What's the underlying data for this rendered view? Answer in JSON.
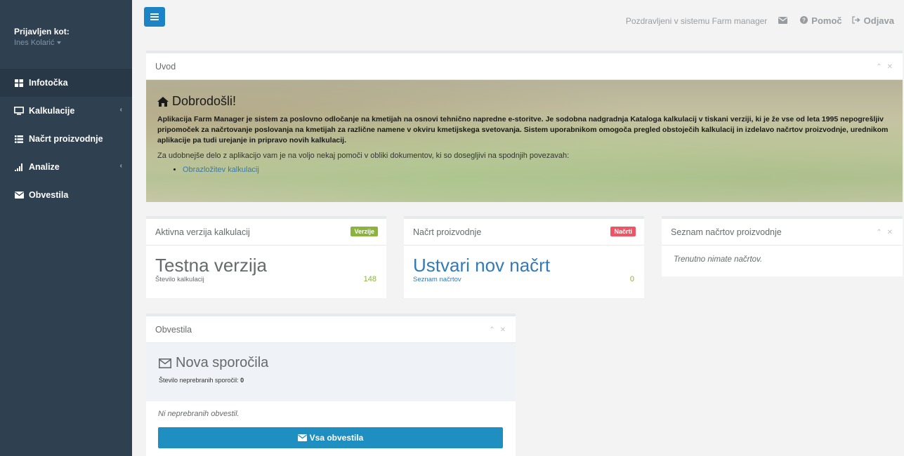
{
  "sidebar": {
    "profile_label": "Prijavljen kot:",
    "user_name": "Ines Kolarić",
    "items": [
      {
        "label": "Infotočka",
        "icon": "grid-icon",
        "active": true
      },
      {
        "label": "Kalkulacije",
        "icon": "desktop-icon",
        "has_submenu": true
      },
      {
        "label": "Načrt proizvodnje",
        "icon": "list-icon"
      },
      {
        "label": "Analize",
        "icon": "bar-chart-icon",
        "has_submenu": true
      },
      {
        "label": "Obvestila",
        "icon": "envelope-icon"
      }
    ]
  },
  "header": {
    "welcome": "Pozdravljeni v sistemu Farm manager",
    "help_label": "Pomoč",
    "logout_label": "Odjava"
  },
  "uvod": {
    "title": "Uvod",
    "heading": "Dobrodošli!",
    "intro": "Aplikacija Farm Manager je sistem za poslovno odločanje na kmetijah na osnovi tehnično napredne e-storitve. Je sodobna nadgradnja Kataloga kalkulacij v tiskani verziji, ki je že vse od leta 1995 nepogrešljiv pripomoček za načrtovanje poslovanja na kmetijah za različne namene v okviru kmetijskega svetovanja. Sistem uporabnikom omogoča pregled obstoječih kalkulacij in izdelavo načrtov proizvodnje, urednikom aplikacije pa tudi urejanje in pripravo novih kalkulacij.",
    "help_text": "Za udobnejše delo z aplikacijo vam je na voljo nekaj pomoči v obliki dokumentov, ki so dosegljivi na spodnjih povezavah:",
    "link": "Obrazložitev kalkulacij"
  },
  "version_box": {
    "title": "Aktivna verzija kalkulacij",
    "badge": "Verzije",
    "badge_color": "#8bb43a",
    "value": "Testna verzija",
    "sub_label": "Število kalkulacij",
    "count": "148"
  },
  "plan_box": {
    "title": "Načrt proizvodnje",
    "badge": "Načrti",
    "badge_color": "#ed5565",
    "value": "Ustvari nov načrt",
    "sub_label": "Seznam načrtov",
    "count": "0"
  },
  "plans_list": {
    "title": "Seznam načrtov proizvodnje",
    "empty": "Trenutno nimate načrtov."
  },
  "notifications": {
    "title": "Obvestila",
    "heading": "Nova sporočila",
    "unread_label": "Število neprebranih sporočil:",
    "unread_count": "0",
    "empty": "Ni neprebranih obvestil.",
    "button": "Vsa obvestila"
  }
}
